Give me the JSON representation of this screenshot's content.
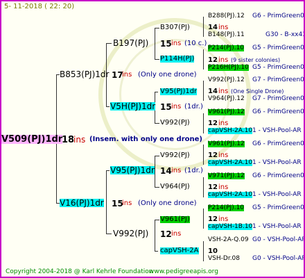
{
  "header": {
    "date": "5- 11-2018 ( 22: 20)"
  },
  "footer": {
    "copyright": "Copyright 2004-2018 @ Karl Kehrle Foundation",
    "site": "www.pedigreeapis.org"
  },
  "root": {
    "name": "V509(PJ)1dr",
    "num": "18",
    "ins": "ins",
    "note": "(Insem. with only one drone)"
  },
  "f1": {
    "name": "B853(PJ)1dr",
    "num": "17",
    "ins": "ins",
    "note": "(Only one drone)"
  },
  "f2": {
    "name": "V16(PJ)1dr",
    "num": "15",
    "ins": "ins",
    "note": "(Only one drone)"
  },
  "ff": {
    "name": "B197(PJ)",
    "num": "15",
    "ins": "ins",
    "note": "(10 c.)"
  },
  "fm": {
    "name": "V5H(PJ)1dr",
    "num": "15",
    "ins": "ins",
    "note": "(1dr.)"
  },
  "mf": {
    "name": "V95(PJ)1dr",
    "num": "14",
    "ins": "ins",
    "note": "(1dr.)"
  },
  "mm": {
    "name": "V992(PJ)",
    "num": "12",
    "ins": "ins"
  },
  "g1": {
    "name": "B307(PJ)",
    "num": "14",
    "ins": "ins"
  },
  "g2": {
    "name": "P114H(PJ)",
    "num": "12",
    "ins": "ins",
    "note": "(9 sister colonies)"
  },
  "g3": {
    "name": "V95(PJ)1dr",
    "num": "14",
    "ins": "ins",
    "note": "(One Single Drone)"
  },
  "g4": {
    "name": "V992(PJ)",
    "num": "12",
    "ins": "ins"
  },
  "g5": {
    "name": "V992(PJ)",
    "num": "12",
    "ins": "ins"
  },
  "g6": {
    "name": "V964(PJ)",
    "num": "12",
    "ins": "ins"
  },
  "g7": {
    "name": "V961(PJ)",
    "num": "12",
    "ins": "ins"
  },
  "g8": {
    "name": "capVSH-2A",
    "num": "10"
  },
  "leaves": [
    {
      "name": "B288(PJ).12",
      "src": "G6 - PrimGreen00"
    },
    {
      "name": "B148(PJ).11",
      "src": "G30 - B-xx43"
    },
    {
      "name": "P214(PJ).10",
      "src": "G5 - PrimGreen00"
    },
    {
      "name": "P216H(PJ).10",
      "src": "G5 - PrimGreen00"
    },
    {
      "name": "V992(PJ).12",
      "src": "G7 - PrimGreen00"
    },
    {
      "name": "V964(PJ).12",
      "src": "G7 - PrimGreen00"
    },
    {
      "name": "V961(PJ).12",
      "src": "G6 - PrimGreen00"
    },
    {
      "name": "capVSH-2A.10",
      "src": "1 - VSH-Pool-AR"
    },
    {
      "name": "V961(PJ).12",
      "src": "G6 - PrimGreen00"
    },
    {
      "name": "capVSH-2A.10",
      "src": "1 - VSH-Pool-AR"
    },
    {
      "name": "V971(PJ).12",
      "src": "G6 - PrimGreen00"
    },
    {
      "name": "capVSH-2A.10",
      "src": "1 - VSH-Pool-AR"
    },
    {
      "name": "P214(PJ).10",
      "src": "G5 - PrimGreen00"
    },
    {
      "name": "capVSH-1B.10",
      "src": "1 - VSH-Pool-AR"
    },
    {
      "name": "VSH-2A-Q.09",
      "src": "G0 - VSH-Pool-AR"
    },
    {
      "name": "VSH-Dr.08",
      "src": "G0 - VSH-Pool-AR"
    }
  ],
  "colors": {
    "frame": "#c800c8",
    "cyan": "#00f0f0",
    "green": "#00d000",
    "pink": "#ffb4ff",
    "ins": "#c80000"
  }
}
